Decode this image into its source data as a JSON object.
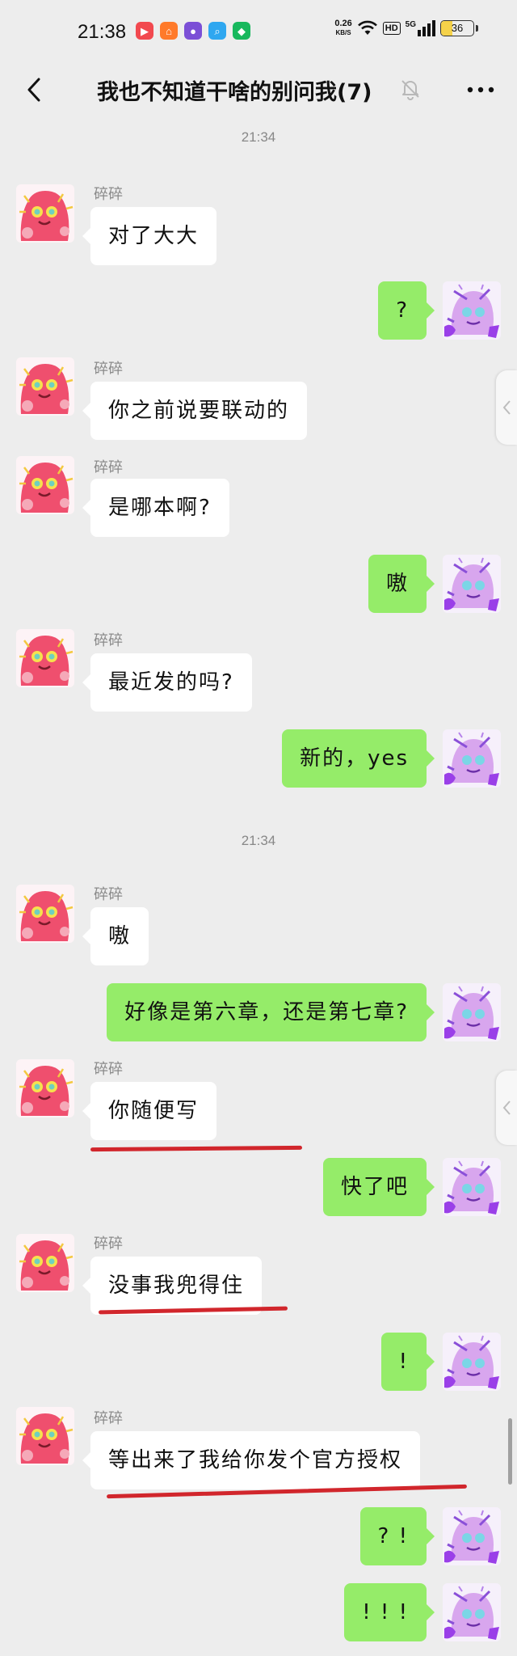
{
  "status_bar": {
    "time": "21:38",
    "apps": [
      {
        "icon": "video-app-icon",
        "color": "#f2494f",
        "glyph": "▶"
      },
      {
        "icon": "home-app-icon",
        "color": "#ff7a2a",
        "glyph": "⌂"
      },
      {
        "icon": "chat-app-icon",
        "color": "#7b4fd6",
        "glyph": "●"
      },
      {
        "icon": "search-app-icon",
        "color": "#2fa7f0",
        "glyph": "⌕"
      },
      {
        "icon": "shield-app-icon",
        "color": "#18b85d",
        "glyph": "◆"
      }
    ],
    "net_speed_value": "0.26",
    "net_speed_unit": "KB/S",
    "hd": "HD",
    "network": "5G",
    "battery": "36",
    "battery_level": 0.36
  },
  "nav": {
    "title": "我也不知道干啥的别问我(7)"
  },
  "timestamps": [
    "21:34",
    "21:34"
  ],
  "sender_name": "碎碎",
  "messages": [
    {
      "side": "left",
      "text": "对了大大"
    },
    {
      "side": "right",
      "text": "?"
    },
    {
      "side": "left",
      "text": "你之前说要联动的"
    },
    {
      "side": "left",
      "text": "是哪本啊?"
    },
    {
      "side": "right",
      "text": "嗷"
    },
    {
      "side": "left",
      "text": "最近发的吗?"
    },
    {
      "side": "right",
      "text": "新的，yes"
    },
    {
      "side": "left",
      "text": "嗷"
    },
    {
      "side": "right",
      "text": "好像是第六章，还是第七章?"
    },
    {
      "side": "left",
      "text": "你随便写"
    },
    {
      "side": "right",
      "text": "快了吧"
    },
    {
      "side": "left",
      "text": "没事我兜得住"
    },
    {
      "side": "right",
      "text": "!"
    },
    {
      "side": "left",
      "text": "等出来了我给你发个官方授权"
    },
    {
      "side": "right",
      "text": "? !"
    },
    {
      "side": "right",
      "text": "! ! !"
    }
  ],
  "colors": {
    "background": "#ededed",
    "self_bubble": "#95ec69",
    "other_bubble": "#ffffff",
    "annotation": "#d1262c"
  }
}
